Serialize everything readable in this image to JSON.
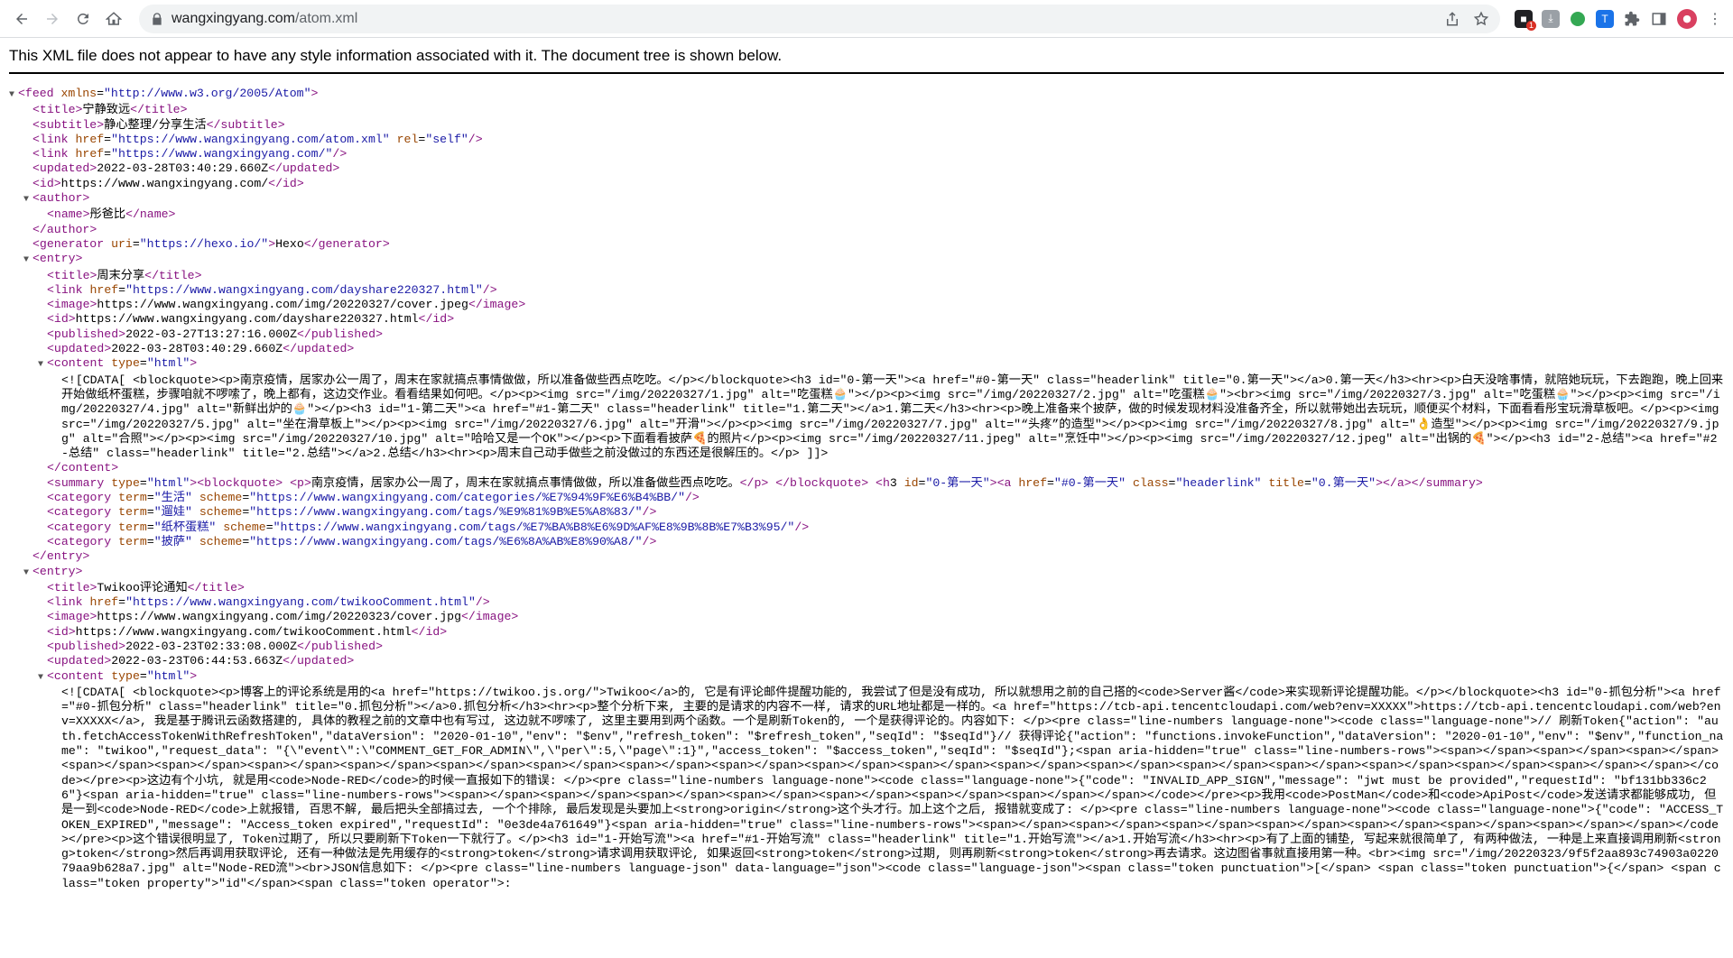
{
  "browser": {
    "url_host": "wangxingyang.com",
    "url_path": "/atom.xml",
    "extension_badge": "1",
    "ext_t_label": "T"
  },
  "notice": "This XML file does not appear to have any style information associated with it. The document tree is shown below.",
  "xml_lines": [
    "<feed xmlns=\"http://www.w3.org/2005/Atom\">",
    "<title>宁静致远</title>",
    "<subtitle>静心整理/分享生活</subtitle>",
    "<link href=\"https://www.wangxingyang.com/atom.xml\" rel=\"self\"/>",
    "<link href=\"https://www.wangxingyang.com/\"/>",
    "<updated>2022-03-28T03:40:29.660Z</updated>",
    "<id>https://www.wangxingyang.com/</id>",
    "<author>",
    "<name>彤爸比</name>",
    "</author>",
    "<generator uri=\"https://hexo.io/\">Hexo</generator>",
    "<entry>",
    "<title>周末分享</title>",
    "<link href=\"https://www.wangxingyang.com/dayshare220327.html\"/>",
    "<image>https://www.wangxingyang.com/img/20220327/cover.jpeg</image>",
    "<id>https://www.wangxingyang.com/dayshare220327.html</id>",
    "<published>2022-03-27T13:27:16.000Z</published>",
    "<updated>2022-03-28T03:40:29.660Z</updated>",
    "<content type=\"html\">",
    "<![CDATA[ <blockquote><p>南京疫情，居家办公一周了，周末在家就搞点事情做做，所以准备做些西点吃吃。</p></blockquote><h3 id=\"0-第一天\"><a href=\"#0-第一天\" class=\"headerlink\" title=\"0.第一天\"></a>0.第一天</h3><hr><p>白天没啥事情，就陪她玩玩，下去跑跑，晚上回来开始做纸杯蛋糕，步骤咱就不啰嗦了，晚上都有，这边交作业。看看结果如何吧。</p><p><img src=\"/img/20220327/1.jpg\" alt=\"吃蛋糕🧁\"></p><p><img src=\"/img/20220327/2.jpg\" alt=\"吃蛋糕🧁\"><br><img src=\"/img/20220327/3.jpg\" alt=\"吃蛋糕🧁\"></p><p><img src=\"/img/20220327/4.jpg\" alt=\"新鲜出炉的🧁\"></p><h3 id=\"1-第二天\"><a href=\"#1-第二天\" class=\"headerlink\" title=\"1.第二天\"></a>1.第二天</h3><hr><p>晚上准备来个披萨，做的时候发现材料没准备齐全，所以就带她出去玩玩，顺便买个材料，下面看看彤宝玩滑草板吧。</p><p><img src=\"/img/20220327/5.jpg\" alt=\"坐在滑草板上\"></p><p><img src=\"/img/20220327/6.jpg\" alt=\"开滑\"></p><p><img src=\"/img/20220327/7.jpg\" alt=\"“头疼”的造型\"></p><p><img src=\"/img/20220327/8.jpg\" alt=\"👌造型\"></p><p><img src=\"/img/20220327/9.jpg\" alt=\"合照\"></p><p><img src=\"/img/20220327/10.jpg\" alt=\"哈哈又是一个OK\"></p><p>下面看看披萨🍕的照片</p><p><img src=\"/img/20220327/11.jpeg\" alt=\"烹饪中\"></p><p><img src=\"/img/20220327/12.jpeg\" alt=\"出锅的🍕\"></p><h3 id=\"2-总结\"><a href=\"#2-总结\" class=\"headerlink\" title=\"2.总结\"></a>2.总结</h3><hr><p>周末自己动手做些之前没做过的东西还是很解压的。</p> ]]>",
    "</content>",
    "<summary type=\"html\"><blockquote> <p>南京疫情，居家办公一周了，周末在家就搞点事情做做，所以准备做些西点吃吃。</p> </blockquote> <h3 id=\"0-第一天\"><a href=\"#0-第一天\" class=\"headerlink\" title=\"0.第一天\"></a></summary>",
    "<category term=\"生活\" scheme=\"https://www.wangxingyang.com/categories/%E7%94%9F%E6%B4%BB/\"/>",
    "<category term=\"遛娃\" scheme=\"https://www.wangxingyang.com/tags/%E9%81%9B%E5%A8%83/\"/>",
    "<category term=\"纸杯蛋糕\" scheme=\"https://www.wangxingyang.com/tags/%E7%BA%B8%E6%9D%AF%E8%9B%8B%E7%B3%95/\"/>",
    "<category term=\"披萨\" scheme=\"https://www.wangxingyang.com/tags/%E6%8A%AB%E8%90%A8/\"/>",
    "</entry>",
    "<entry>",
    "<title>Twikoo评论通知</title>",
    "<link href=\"https://www.wangxingyang.com/twikooComment.html\"/>",
    "<image>https://www.wangxingyang.com/img/20220323/cover.jpg</image>",
    "<id>https://www.wangxingyang.com/twikooComment.html</id>",
    "<published>2022-03-23T02:33:08.000Z</published>",
    "<updated>2022-03-23T06:44:53.663Z</updated>",
    "<content type=\"html\">",
    "<![CDATA[ <blockquote><p>博客上的评论系统是用的<a href=\"https://twikoo.js.org/\">Twikoo</a>的, 它是有评论邮件提醒功能的, 我尝试了但是没有成功, 所以就想用之前的自己搭的<code>Server酱</code>来实现新评论提醒功能。</p></blockquote><h3 id=\"0-抓包分析\"><a href=\"#0-抓包分析\" class=\"headerlink\" title=\"0.抓包分析\"></a>0.抓包分析</h3><hr><p>整个分析下来, 主要的是请求的内容不一样, 请求的URL地址都是一样的。<a href=\"https://tcb-api.tencentcloudapi.com/web?env=XXXXX\">https://tcb-api.tencentcloudapi.com/web?env=XXXXX</a>, 我是基于腾讯云函数搭建的, 具体的教程之前的文章中也有写过, 这边就不啰嗦了, 这里主要用到两个函数。一个是刷新Token的, 一个是获得评论的。内容如下: </p><pre class=\"line-numbers language-none\"><code class=\"language-none\">// 刷新Token{\"action\": \"auth.fetchAccessTokenWithRefreshToken\",\"dataVersion\": \"2020-01-10\",\"env\": \"$env\",\"refresh_token\": \"$refresh_token\",\"seqId\": \"$seqId\"}// 获得评论{\"action\": \"functions.invokeFunction\",\"dataVersion\": \"2020-01-10\",\"env\": \"$env\",\"function_name\": \"twikoo\",\"request_data\": \"{\\\"event\\\":\\\"COMMENT_GET_FOR_ADMIN\\\",\\\"per\\\":5,\\\"page\\\":1}\",\"access_token\": \"$access_token\",\"seqId\": \"$seqId\"};<span aria-hidden=\"true\" class=\"line-numbers-rows\"><span></span><span></span><span></span><span></span><span></span><span></span><span></span><span></span><span></span><span></span><span></span><span></span><span></span><span></span><span></span><span></span><span></span><span></span><span></span><span></span></span></code></pre><p>这边有个小坑, 就是用<code>Node-RED</code>的时候一直报如下的错误: </p><pre class=\"line-numbers language-none\"><code class=\"language-none\">{\"code\": \"INVALID_APP_SIGN\",\"message\": \"jwt must be provided\",\"requestId\": \"bf131bb336c26\"}<span aria-hidden=\"true\" class=\"line-numbers-rows\"><span></span><span></span><span></span><span></span><span></span><span></span><span></span></span></code></pre><p>我用<code>PostMan</code>和<code>ApiPost</code>发送请求都能够成功, 但是一到<code>Node-RED</code>上就报错, 百思不解, 最后把头全部搞过去, 一个个排除, 最后发现是头要加上<strong>origin</strong>这个头才行。加上这个之后, 报错就变成了: </p><pre class=\"line-numbers language-none\"><code class=\"language-none\">{\"code\": \"ACCESS_TOKEN_EXPIRED\",\"message\": \"Access_token expired\",\"requestId\": \"0e3de4a761649\"}<span aria-hidden=\"true\" class=\"line-numbers-rows\"><span></span><span></span><span></span><span></span><span></span><span></span><span></span></span></code></pre><p>这个错误很明显了, Token过期了, 所以只要刷新下Token一下就行了。</p><h3 id=\"1-开始写流\"><a href=\"#1-开始写流\" class=\"headerlink\" title=\"1.开始写流\"></a>1.开始写流</h3><hr><p>有了上面的铺垫, 写起来就很简单了, 有两种做法, 一种是上来直接调用刷新<strong>token</strong>然后再调用获取评论, 还有一种做法是先用缓存的<strong>token</strong>请求调用获取评论, 如果返回<strong>token</strong>过期, 则再刷新<strong>token</strong>再去请求。这边图省事就直接用第一种。<br><img src=\"/img/20220323/9f5f2aa893c74903a022079aa9b628a7.jpg\" alt=\"Node-RED流\"><br>JSON信息如下: </p><pre class=\"line-numbers language-json\" data-language=\"json\"><code class=\"language-json\"><span class=\"token punctuation\">[</span> <span class=\"token punctuation\">{</span> <span class=\"token property\">\"id\"</span><span class=\"token operator\">:"
  ]
}
